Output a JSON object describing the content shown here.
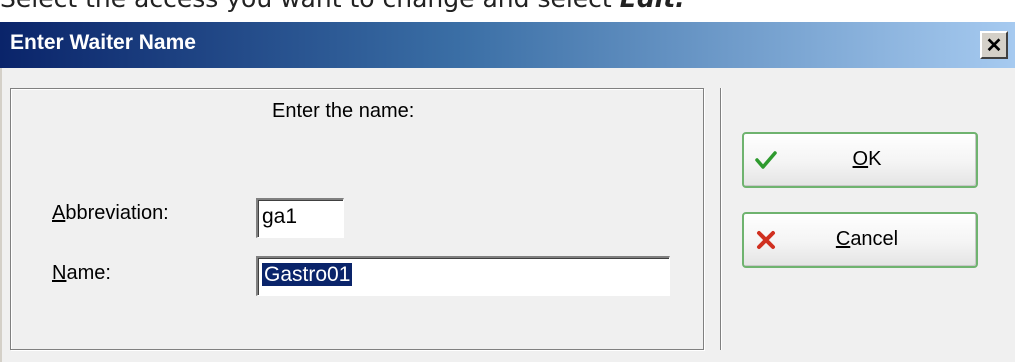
{
  "document": {
    "instruction_prefix": "Select the access you want to change and select ",
    "instruction_emphasis": "Edit."
  },
  "dialog": {
    "title": "Enter Waiter Name",
    "close_glyph": "✕",
    "prompt": "Enter the name:",
    "abbreviation": {
      "label_key": "A",
      "label_rest": "bbreviation:",
      "value": "ga1"
    },
    "name": {
      "label_key": "N",
      "label_rest": "ame:",
      "value": "Gastro01"
    },
    "ok": {
      "label_key": "O",
      "label_rest": "K",
      "icon": "checkmark-icon"
    },
    "cancel": {
      "label_key": "C",
      "label_rest": "ancel",
      "icon": "cross-icon"
    }
  },
  "colors": {
    "title_start": "#0a246a",
    "title_end": "#a6caf0",
    "selection": "#0a246a",
    "ok_check": "#2e9a2e",
    "cancel_cross": "#d03020",
    "button_border": "#6fb36f"
  }
}
